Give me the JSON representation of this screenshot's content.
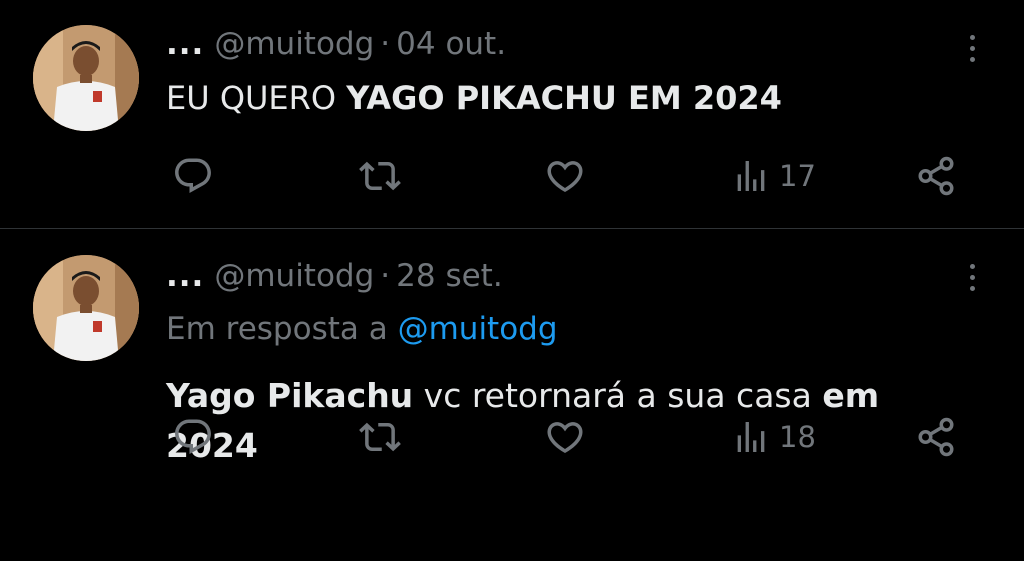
{
  "tweets": [
    {
      "more_glyph": "...",
      "handle": "@muitodg",
      "separator": "·",
      "date": "04 out.",
      "text_parts": {
        "t0": "EU QUERO ",
        "t1": "YAGO PIKACHU EM 2024"
      },
      "views": "17"
    },
    {
      "more_glyph": "...",
      "handle": "@muitodg",
      "separator": "·",
      "date": "28 set.",
      "reply_prefix": "Em resposta a",
      "reply_mention": "@muitodg",
      "text_parts": {
        "t0": "Yago Pikachu",
        "t1": " vc retornará a sua casa ",
        "t2": "em",
        "t3": " 2024"
      },
      "views": "18"
    }
  ],
  "icons": [
    "reply-icon",
    "retweet-icon",
    "like-icon",
    "views-icon",
    "share-icon",
    "more-options-icon"
  ],
  "colors": {
    "background": "#000000",
    "text": "#e7e9ea",
    "muted": "#71767b",
    "link": "#1d9bf0",
    "divider": "#2f3336"
  }
}
